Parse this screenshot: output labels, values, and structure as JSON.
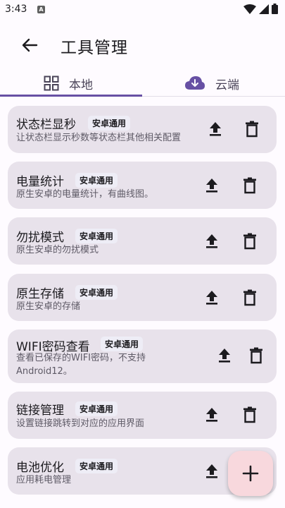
{
  "status": {
    "time": "3:43",
    "app_badge": "A"
  },
  "header": {
    "title": "工具管理"
  },
  "tabs": [
    {
      "label": "本地",
      "icon": "grid-icon",
      "selected": true
    },
    {
      "label": "云端",
      "icon": "cloud-download-icon",
      "selected": false
    }
  ],
  "tools": [
    {
      "title": "状态栏显秒",
      "badge": "安卓通用",
      "desc": "让状态栏显示秒数等状态栏其他相关配置"
    },
    {
      "title": "电量统计",
      "badge": "安卓通用",
      "desc": "原生安卓的电量统计，有曲线图。"
    },
    {
      "title": "勿扰模式",
      "badge": "安卓通用",
      "desc": "原生安卓的勿扰模式"
    },
    {
      "title": "原生存储",
      "badge": "安卓通用",
      "desc": "原生安卓的存储"
    },
    {
      "title": "WIFI密码查看",
      "badge": "安卓通用",
      "desc": "查看已保存的WIFI密码，不支持",
      "desc2": "Android12。"
    },
    {
      "title": "链接管理",
      "badge": "安卓通用",
      "desc": "设置链接跳转到对应的应用界面"
    },
    {
      "title": "电池优化",
      "badge": "安卓通用",
      "desc": "应用耗电管理"
    }
  ],
  "colors": {
    "primary": "#6750a4",
    "card": "#e8e2eb",
    "fab": "#f8d8dd"
  }
}
